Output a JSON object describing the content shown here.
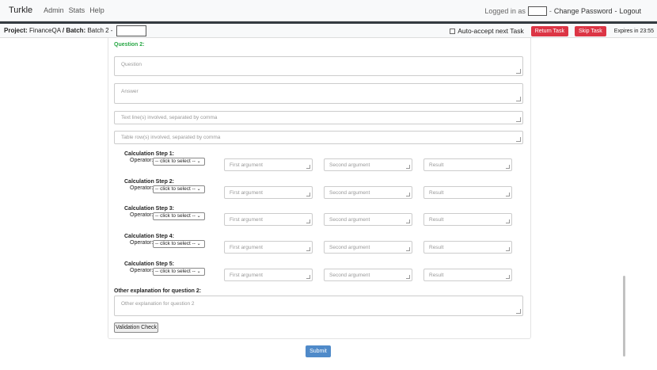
{
  "nav": {
    "brand": "Turkle",
    "links": [
      "Admin",
      "Stats",
      "Help"
    ],
    "logged_in_prefix": "Logged in as",
    "change_password": "Change Password",
    "separator": "-",
    "logout": "Logout"
  },
  "taskbar": {
    "project_label": "Project:",
    "project_name": "FinanceQA",
    "slash": "/",
    "batch_label": "Batch:",
    "batch_name": "Batch 2 -",
    "auto_accept": "Auto-accept next Task",
    "return_task": "Return Task",
    "skip_task": "Skip Task",
    "expires": "Expires in 23:55"
  },
  "form": {
    "question_heading": "Question 2:",
    "question_placeholder": "Question",
    "answer_placeholder": "Answer",
    "text_lines_placeholder": "Text line(s) involved, separated by comma",
    "table_rows_placeholder": "Table row(s) involved, separated by comma",
    "operator_label": "Operator:",
    "operator_default": "-- click to select --",
    "first_argument": "First argument",
    "second_argument": "Second argument",
    "result": "Result",
    "steps": [
      {
        "label": "Calculation Step 1:"
      },
      {
        "label": "Calculation Step 2:"
      },
      {
        "label": "Calculation Step 3:"
      },
      {
        "label": "Calculation Step 4:"
      },
      {
        "label": "Calculation Step 5:"
      }
    ],
    "other_label": "Other explanation for question 2:",
    "other_placeholder": "Other explanation for question 2",
    "validation_check": "Validation Check",
    "submit": "Submit"
  },
  "colors": {
    "danger": "#dc3545",
    "primary": "#4f8ac9",
    "success": "#28a745"
  }
}
